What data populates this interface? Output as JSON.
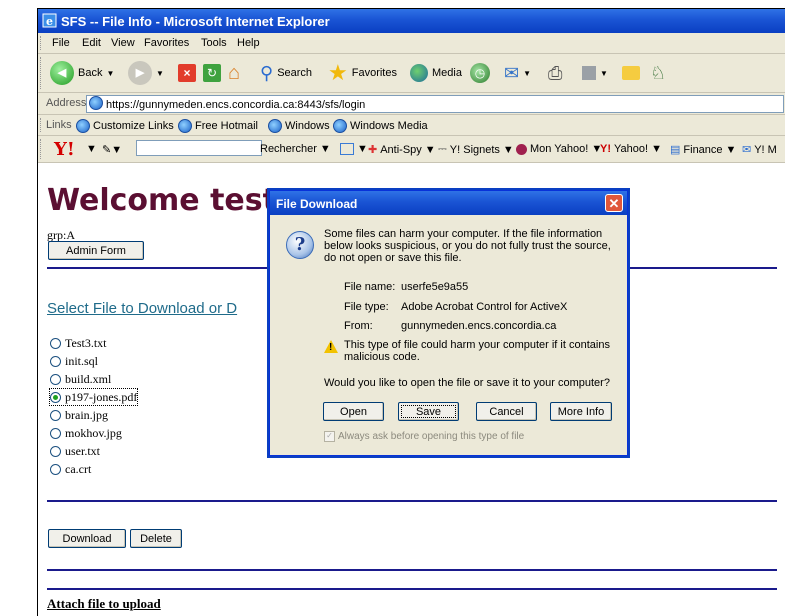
{
  "window": {
    "title": "SFS -- File Info - Microsoft Internet Explorer"
  },
  "menu": [
    "File",
    "Edit",
    "View",
    "Favorites",
    "Tools",
    "Help"
  ],
  "toolbar": {
    "back": "Back",
    "search": "Search",
    "favorites": "Favorites",
    "media": "Media"
  },
  "address": {
    "label": "Address",
    "url": "https://gunnymeden.encs.concordia.ca:8443/sfs/login"
  },
  "links": {
    "label": "Links",
    "items": [
      "Customize Links",
      "Free Hotmail",
      "Windows",
      "Windows Media"
    ]
  },
  "yahoo": {
    "logo": "Y!",
    "search": "Rechercher",
    "antispy": "Anti-Spy",
    "signets": "Y! Signets",
    "myyahoo": "Mon Yahoo!",
    "yahoo": "Yahoo!",
    "finance": "Finance",
    "mail": "Y! M"
  },
  "page": {
    "welcome": "Welcome test",
    "grp": "grp:A",
    "admin_button": "Admin Form",
    "select_link": "Select File to Download or D",
    "files": [
      "Test3.txt",
      "init.sql",
      "build.xml",
      "p197-jones.pdf",
      "brain.jpg",
      "mokhov.jpg",
      "user.txt",
      "ca.crt"
    ],
    "selected_file": "p197-jones.pdf",
    "download_button": "Download",
    "delete_button": "Delete",
    "attach": "Attach file to upload"
  },
  "dialog": {
    "title": "File Download",
    "warning": "Some files can harm your computer. If the file information below looks suspicious, or you do not fully trust the source, do not open or save this file.",
    "file_name_label": "File name:",
    "file_name": "userfe5e9a55",
    "file_type_label": "File type:",
    "file_type": "Adobe Acrobat Control for ActiveX",
    "from_label": "From:",
    "from": "gunnymeden.encs.concordia.ca",
    "malicious": "This type of file could harm your computer if it contains malicious code.",
    "question": "Would you like to open the file or save it to your computer?",
    "open": "Open",
    "save": "Save",
    "cancel": "Cancel",
    "more_info": "More Info",
    "always_ask": "Always ask before opening this type of file"
  }
}
